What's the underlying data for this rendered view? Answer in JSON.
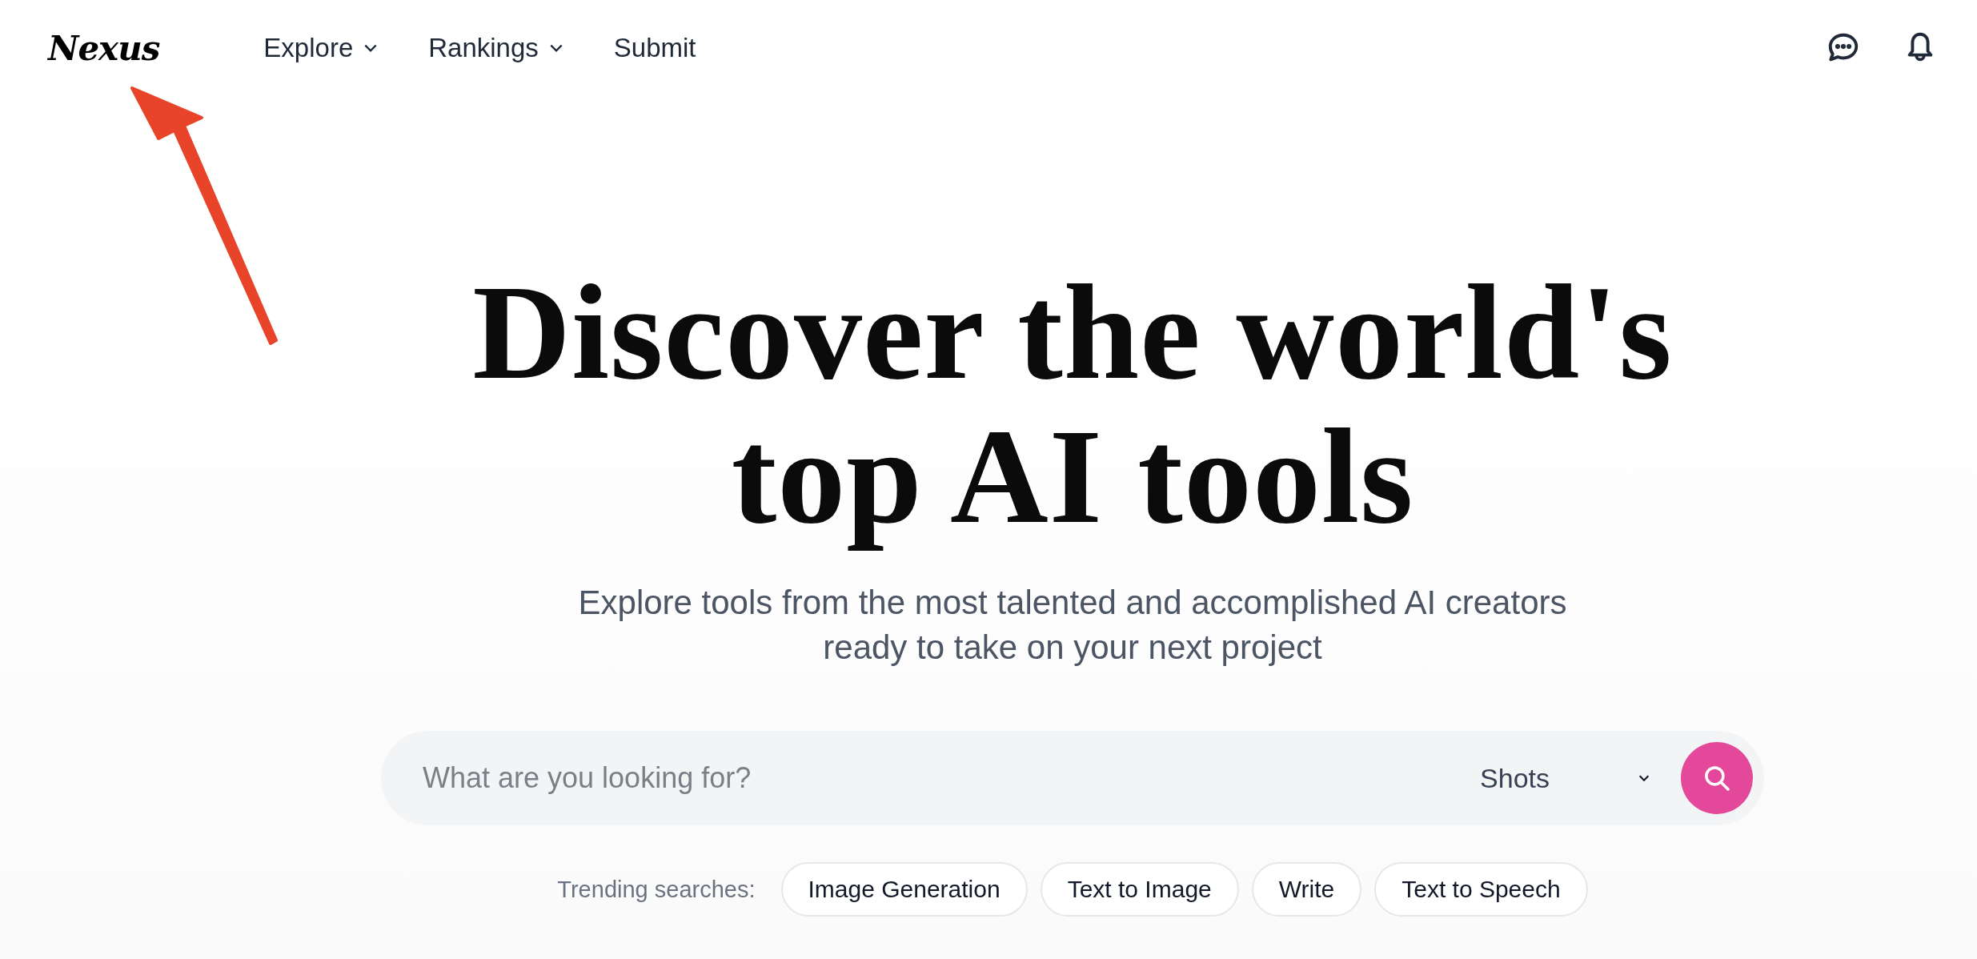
{
  "header": {
    "logo": "Nexus",
    "nav": [
      {
        "label": "Explore",
        "dropdown": true
      },
      {
        "label": "Rankings",
        "dropdown": true
      },
      {
        "label": "Submit",
        "dropdown": false
      }
    ]
  },
  "hero": {
    "title_lines": [
      "Discover the world's",
      "top AI tools"
    ],
    "subtitle_lines": [
      "Explore tools from the most talented and accomplished AI creators",
      "ready to take on your next project"
    ]
  },
  "search": {
    "placeholder": "What are you looking for?",
    "category": "Shots"
  },
  "trending": {
    "label": "Trending searches:",
    "items": [
      "Image Generation",
      "Text to Image",
      "Write",
      "Text to Speech"
    ]
  }
}
